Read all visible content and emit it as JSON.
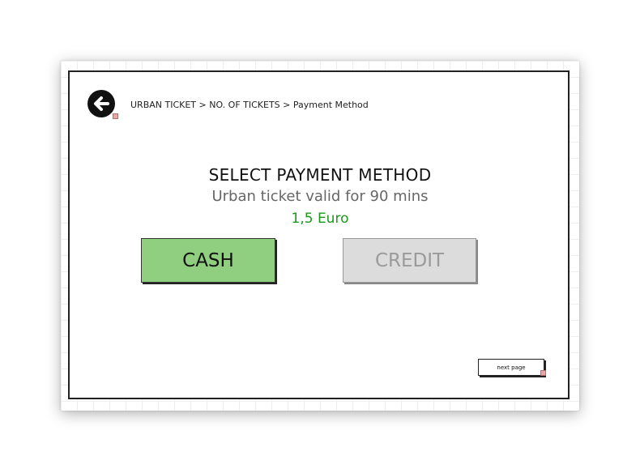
{
  "breadcrumb": {
    "text": "URBAN TICKET > NO. OF TICKETS > Payment Method"
  },
  "back_button": {
    "icon": "arrow-left-icon"
  },
  "main": {
    "heading": "SELECT PAYMENT METHOD",
    "subheading": "Urban ticket valid for 90 mins",
    "price": "1,5 Euro"
  },
  "payment_options": {
    "cash_label": "CASH",
    "credit_label": "CREDIT"
  },
  "footer": {
    "next_label": "next page"
  },
  "colors": {
    "cash_bg": "#8fcf7f",
    "credit_bg": "#dcdcdc",
    "price_text": "#1a9a1a"
  }
}
